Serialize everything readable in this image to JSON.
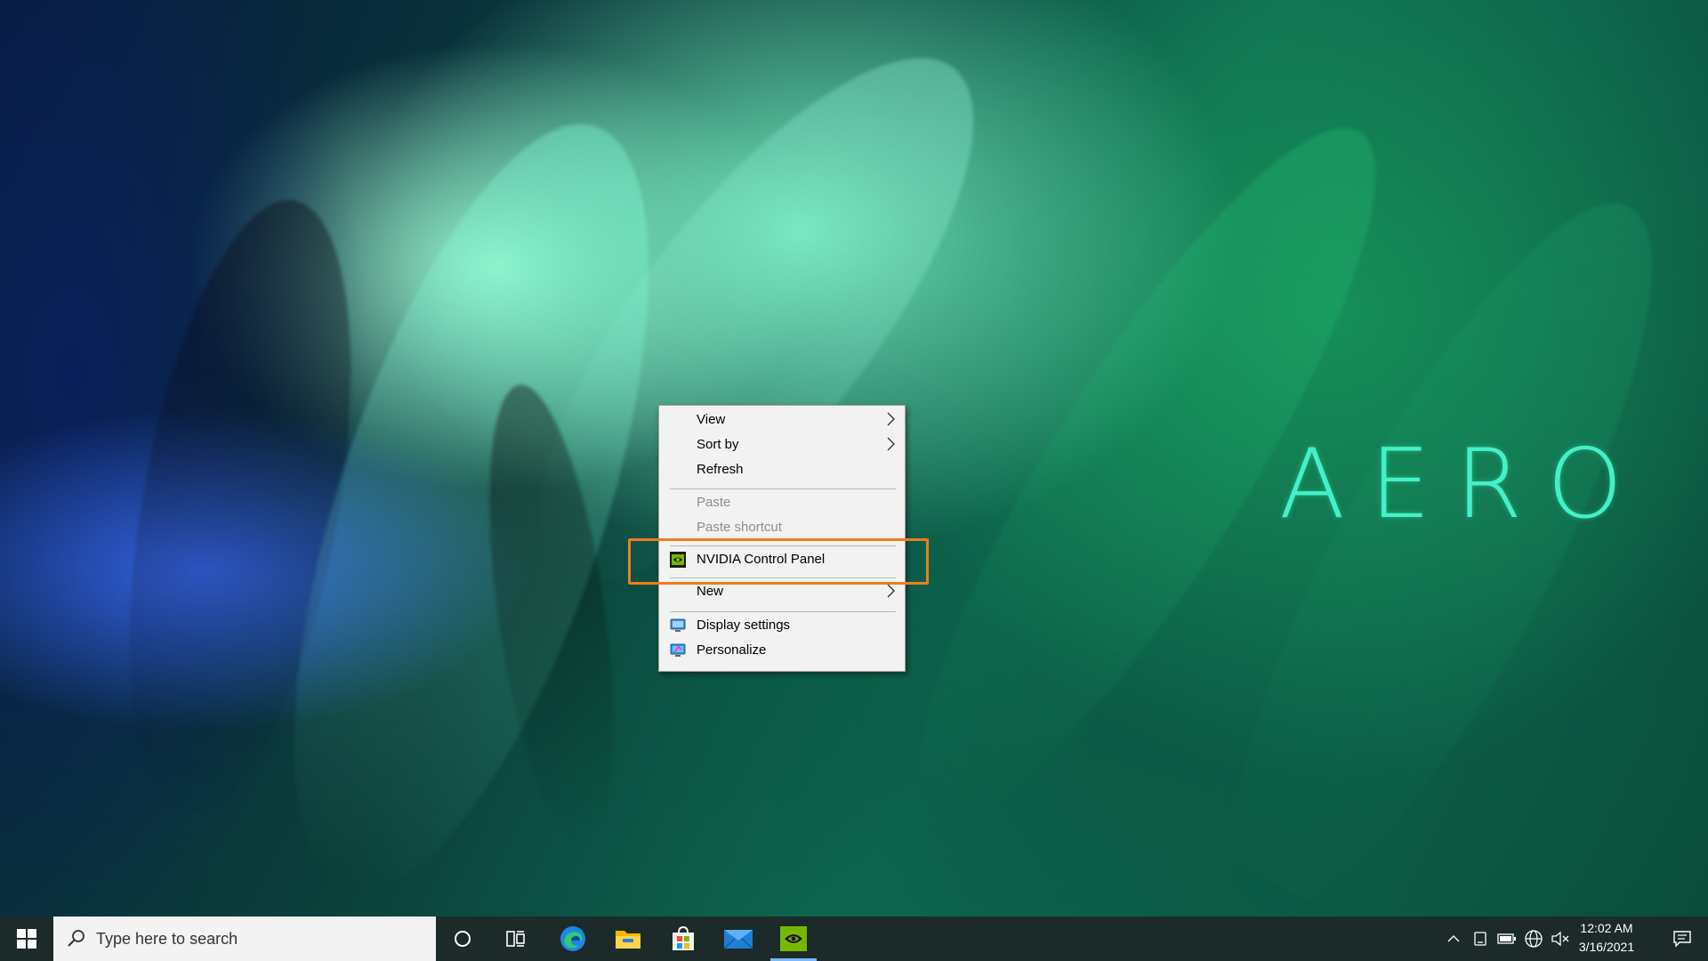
{
  "wallpaper": {
    "brand_text": "AERO",
    "accent_color": "#45f0c8"
  },
  "context_menu": {
    "items": [
      {
        "label": "View",
        "has_submenu": true,
        "disabled": false
      },
      {
        "label": "Sort by",
        "has_submenu": true,
        "disabled": false
      },
      {
        "label": "Refresh",
        "has_submenu": false,
        "disabled": false
      },
      {
        "label": "Paste",
        "has_submenu": false,
        "disabled": true
      },
      {
        "label": "Paste shortcut",
        "has_submenu": false,
        "disabled": true
      },
      {
        "label": "NVIDIA Control Panel",
        "has_submenu": false,
        "disabled": false,
        "icon": "nvidia-icon"
      },
      {
        "label": "New",
        "has_submenu": true,
        "disabled": false
      },
      {
        "label": "Display settings",
        "has_submenu": false,
        "disabled": false,
        "icon": "display-settings-icon"
      },
      {
        "label": "Personalize",
        "has_submenu": false,
        "disabled": false,
        "icon": "personalize-icon"
      }
    ],
    "highlight_color": "#f07c1e"
  },
  "taskbar": {
    "search": {
      "placeholder": "Type here to search"
    },
    "pinned": [
      "cortana-icon",
      "task-view-icon",
      "edge-icon",
      "file-explorer-icon",
      "store-icon",
      "mail-icon",
      "nvidia-app-icon"
    ],
    "active_app": "nvidia-app-icon",
    "clock": {
      "time": "12:02 AM",
      "date": "3/16/2021"
    },
    "tray": [
      "show-hidden-icons-chevron",
      "touch-keyboard-icon",
      "battery-icon",
      "network-icon",
      "volume-muted-icon",
      "action-center-icon"
    ]
  }
}
